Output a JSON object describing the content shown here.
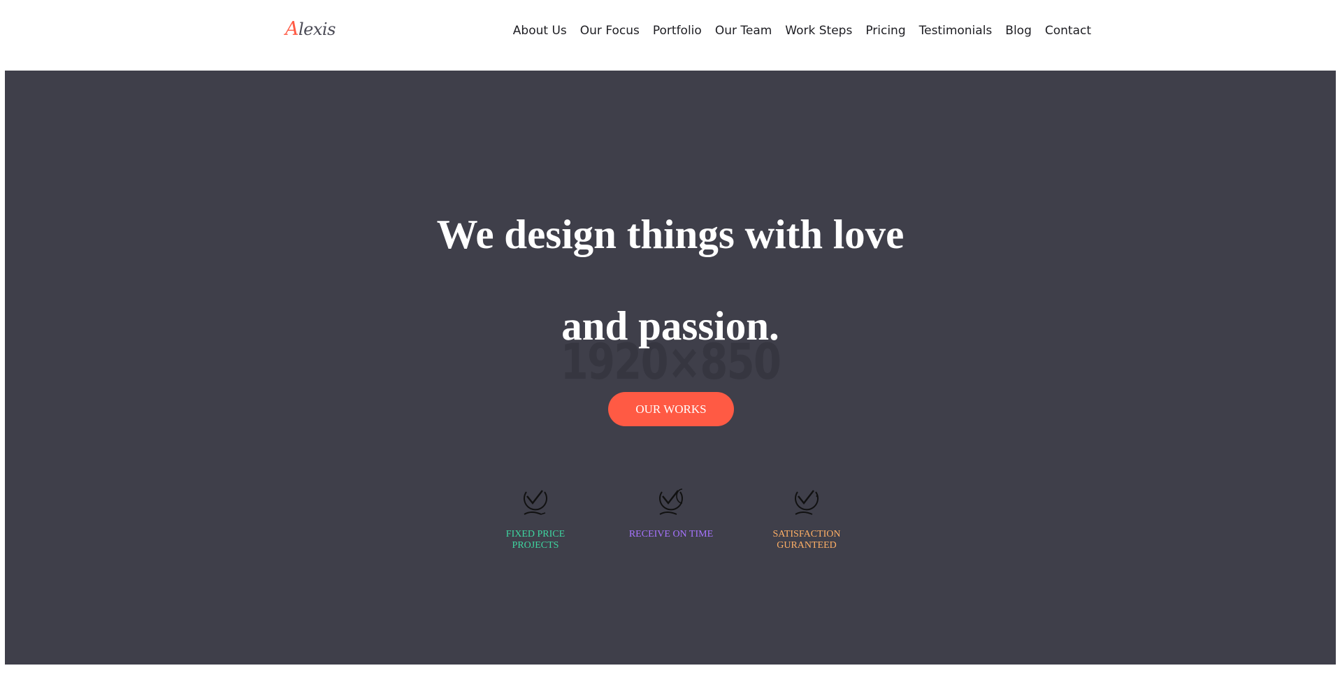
{
  "header": {
    "logo": {
      "initial": "A",
      "rest": "lexis"
    },
    "nav": [
      {
        "label": "About Us"
      },
      {
        "label": "Our Focus"
      },
      {
        "label": "Portfolio"
      },
      {
        "label": "Our Team"
      },
      {
        "label": "Work Steps"
      },
      {
        "label": "Pricing"
      },
      {
        "label": "Testimonials"
      },
      {
        "label": "Blog"
      },
      {
        "label": "Contact"
      }
    ]
  },
  "hero": {
    "placeholder_text": "1920×850",
    "headline_line1": "We design things with love",
    "headline_line2": "and passion.",
    "cta_label": "OUR WORKS",
    "features": [
      {
        "label": "FIXED PRICE\nPROJECTS",
        "color": "#3fd6a0",
        "icon": "check-badge-icon"
      },
      {
        "label": "RECEIVE ON TIME",
        "color": "#a774ff",
        "icon": "check-badge-icon"
      },
      {
        "label": "SATISFACTION\nGURANTEED",
        "color": "#ffb066",
        "icon": "check-badge-icon"
      }
    ]
  },
  "colors": {
    "accent": "#ff5a44",
    "hero_background": "#3f3f4a"
  }
}
